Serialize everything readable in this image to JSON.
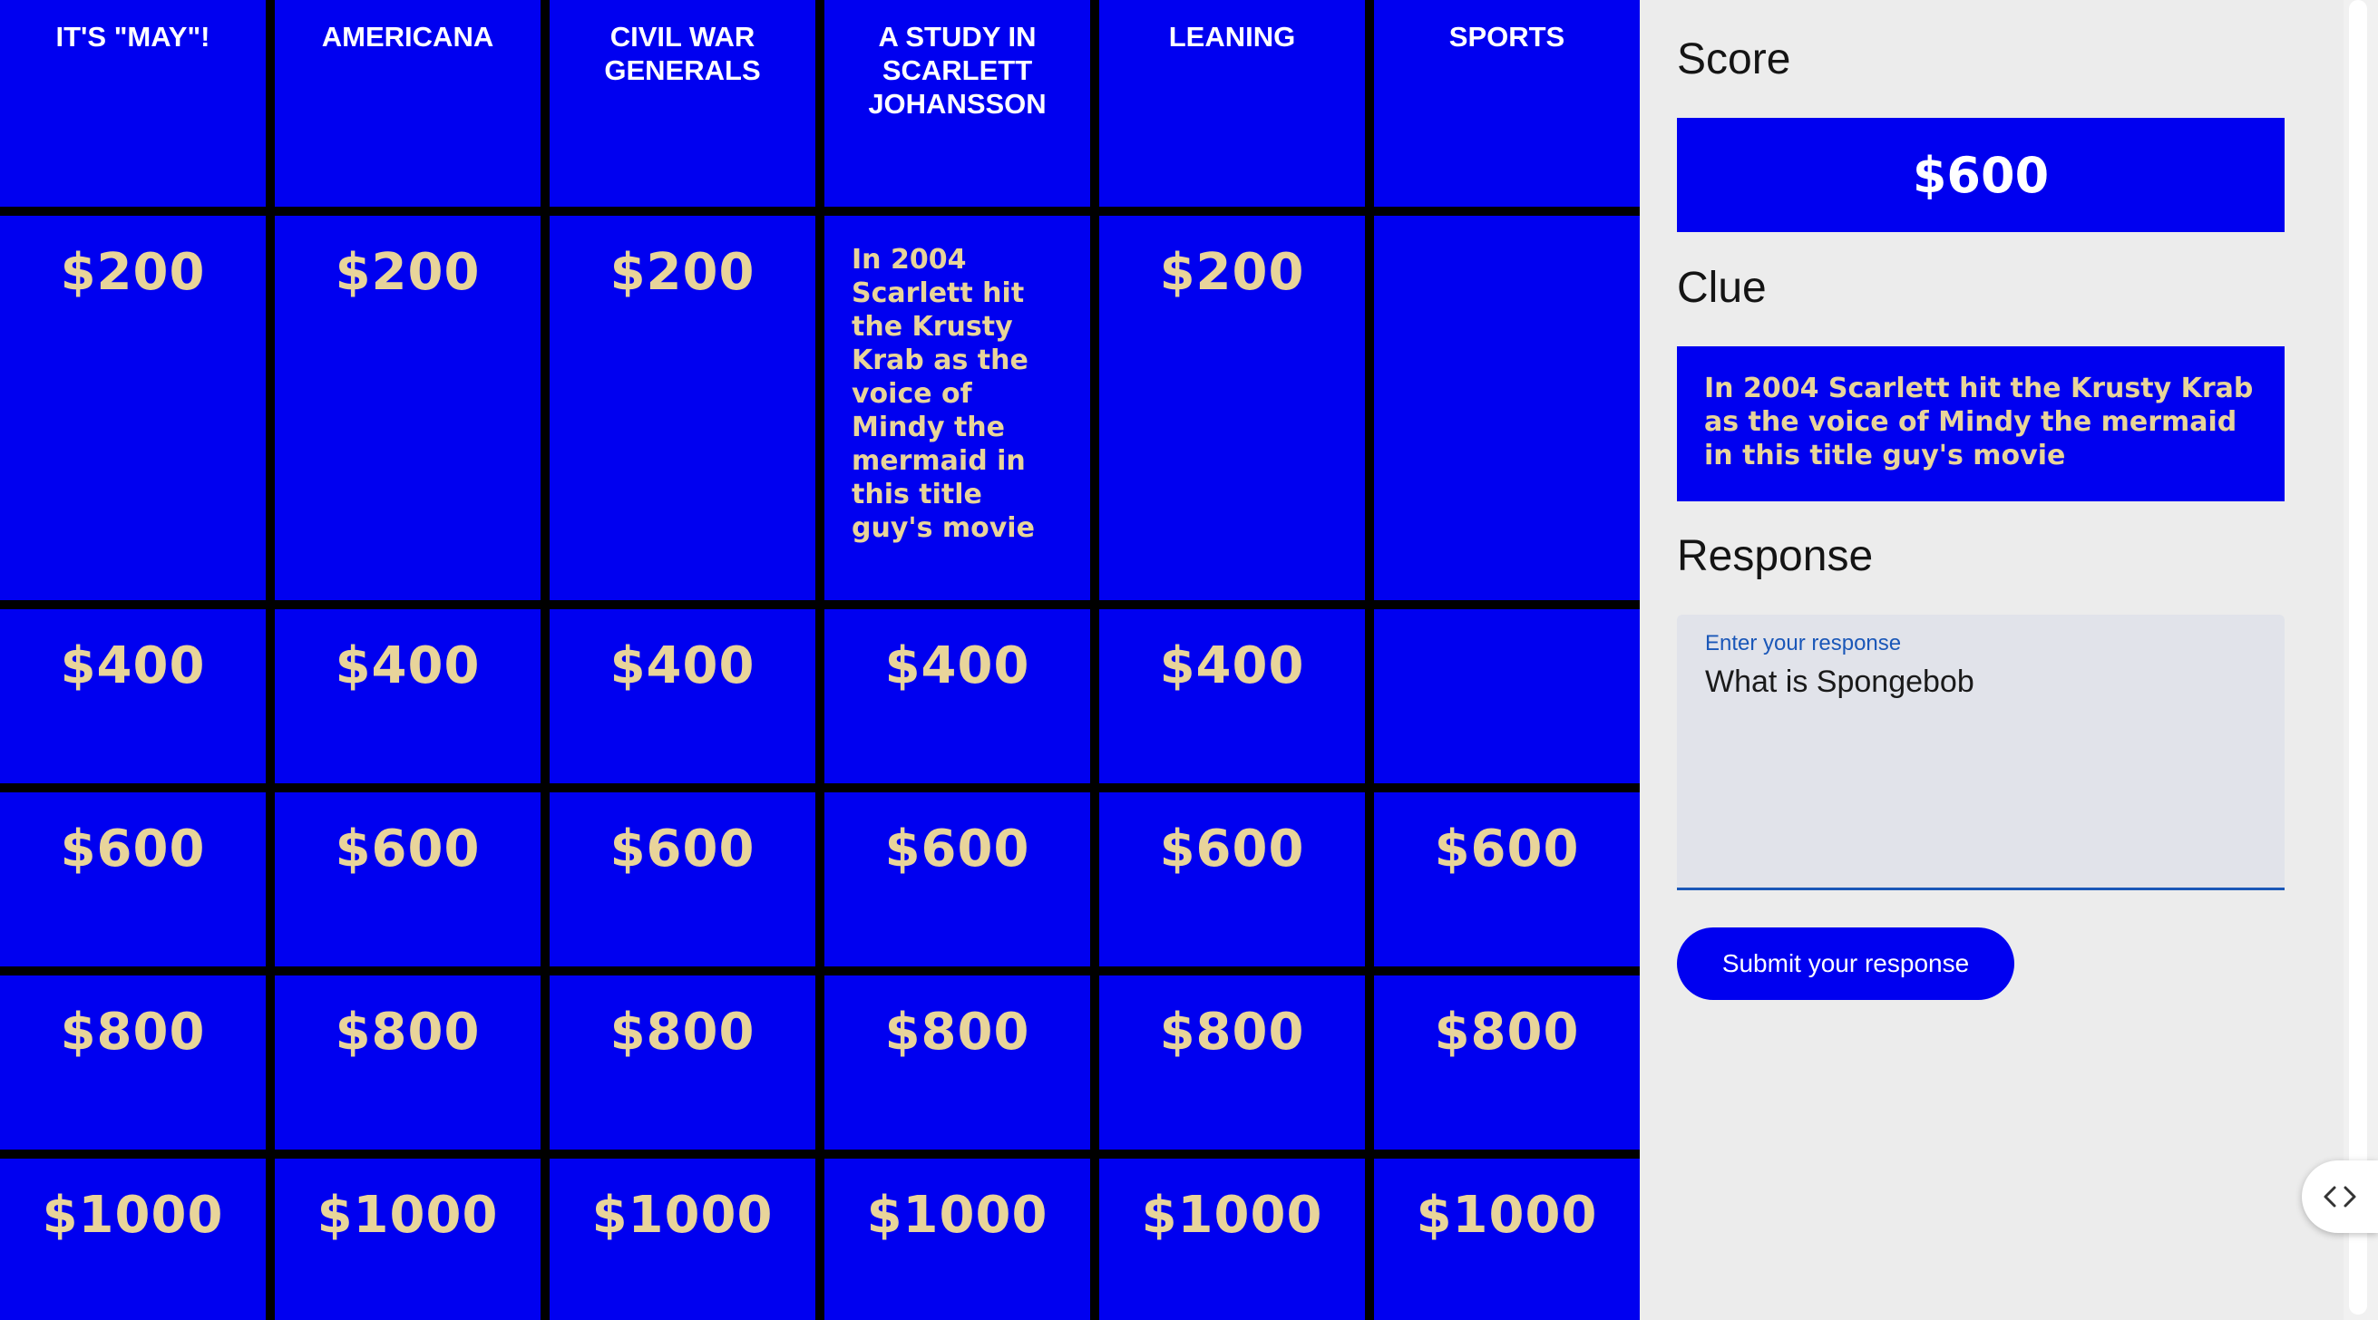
{
  "board": {
    "categories": [
      "IT'S \"MAY\"!",
      "AMERICANA",
      "CIVIL WAR GENERALS",
      "A STUDY IN SCARLETT JOHANSSON",
      "LEANING",
      "SPORTS"
    ],
    "rows": [
      [
        "$200",
        "$200",
        "$200",
        "In 2004 Scarlett hit the Krusty Krab as the voice of Mindy the mermaid in this title guy's movie",
        "$200",
        ""
      ],
      [
        "$400",
        "$400",
        "$400",
        "$400",
        "$400",
        ""
      ],
      [
        "$600",
        "$600",
        "$600",
        "$600",
        "$600",
        "$600"
      ],
      [
        "$800",
        "$800",
        "$800",
        "$800",
        "$800",
        "$800"
      ],
      [
        "$1000",
        "$1000",
        "$1000",
        "$1000",
        "$1000",
        "$1000"
      ]
    ],
    "revealed_cell": {
      "row": 0,
      "col": 3
    },
    "colors": {
      "board_blue": "#0000f0",
      "grid_black": "#000000",
      "money_gold": "#e8d49a",
      "category_white": "#ffffff"
    }
  },
  "panel": {
    "score_title": "Score",
    "score_value": "$600",
    "clue_title": "Clue",
    "clue_text": "In 2004 Scarlett hit the Krusty Krab as the voice of Mindy the mermaid in this title guy's movie",
    "response_title": "Response",
    "response_label": "Enter your response",
    "response_value": "What is Spongebob",
    "submit_label": "Submit your response",
    "colors": {
      "panel_background": "#ececec",
      "field_background": "#e1e3ea",
      "field_accent": "#1a57b8"
    }
  },
  "devtools_toggle": {
    "icon": "code-brackets-icon"
  }
}
